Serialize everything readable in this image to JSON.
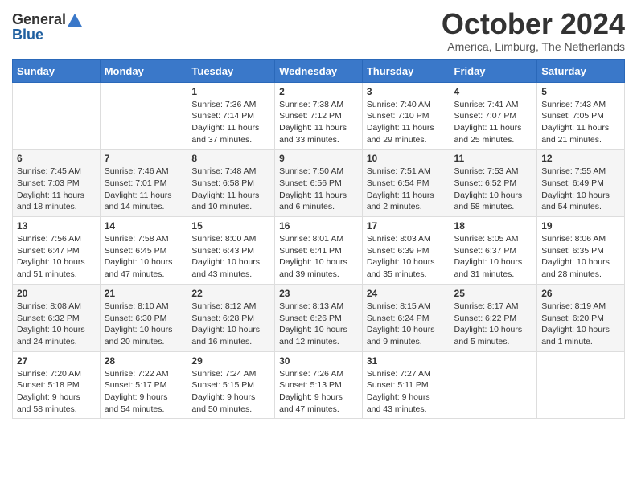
{
  "logo": {
    "line1": "General",
    "line2": "Blue"
  },
  "header": {
    "month": "October 2024",
    "location": "America, Limburg, The Netherlands"
  },
  "days_of_week": [
    "Sunday",
    "Monday",
    "Tuesday",
    "Wednesday",
    "Thursday",
    "Friday",
    "Saturday"
  ],
  "weeks": [
    [
      {
        "day": "",
        "info": ""
      },
      {
        "day": "",
        "info": ""
      },
      {
        "day": "1",
        "info": "Sunrise: 7:36 AM\nSunset: 7:14 PM\nDaylight: 11 hours and 37 minutes."
      },
      {
        "day": "2",
        "info": "Sunrise: 7:38 AM\nSunset: 7:12 PM\nDaylight: 11 hours and 33 minutes."
      },
      {
        "day": "3",
        "info": "Sunrise: 7:40 AM\nSunset: 7:10 PM\nDaylight: 11 hours and 29 minutes."
      },
      {
        "day": "4",
        "info": "Sunrise: 7:41 AM\nSunset: 7:07 PM\nDaylight: 11 hours and 25 minutes."
      },
      {
        "day": "5",
        "info": "Sunrise: 7:43 AM\nSunset: 7:05 PM\nDaylight: 11 hours and 21 minutes."
      }
    ],
    [
      {
        "day": "6",
        "info": "Sunrise: 7:45 AM\nSunset: 7:03 PM\nDaylight: 11 hours and 18 minutes."
      },
      {
        "day": "7",
        "info": "Sunrise: 7:46 AM\nSunset: 7:01 PM\nDaylight: 11 hours and 14 minutes."
      },
      {
        "day": "8",
        "info": "Sunrise: 7:48 AM\nSunset: 6:58 PM\nDaylight: 11 hours and 10 minutes."
      },
      {
        "day": "9",
        "info": "Sunrise: 7:50 AM\nSunset: 6:56 PM\nDaylight: 11 hours and 6 minutes."
      },
      {
        "day": "10",
        "info": "Sunrise: 7:51 AM\nSunset: 6:54 PM\nDaylight: 11 hours and 2 minutes."
      },
      {
        "day": "11",
        "info": "Sunrise: 7:53 AM\nSunset: 6:52 PM\nDaylight: 10 hours and 58 minutes."
      },
      {
        "day": "12",
        "info": "Sunrise: 7:55 AM\nSunset: 6:49 PM\nDaylight: 10 hours and 54 minutes."
      }
    ],
    [
      {
        "day": "13",
        "info": "Sunrise: 7:56 AM\nSunset: 6:47 PM\nDaylight: 10 hours and 51 minutes."
      },
      {
        "day": "14",
        "info": "Sunrise: 7:58 AM\nSunset: 6:45 PM\nDaylight: 10 hours and 47 minutes."
      },
      {
        "day": "15",
        "info": "Sunrise: 8:00 AM\nSunset: 6:43 PM\nDaylight: 10 hours and 43 minutes."
      },
      {
        "day": "16",
        "info": "Sunrise: 8:01 AM\nSunset: 6:41 PM\nDaylight: 10 hours and 39 minutes."
      },
      {
        "day": "17",
        "info": "Sunrise: 8:03 AM\nSunset: 6:39 PM\nDaylight: 10 hours and 35 minutes."
      },
      {
        "day": "18",
        "info": "Sunrise: 8:05 AM\nSunset: 6:37 PM\nDaylight: 10 hours and 31 minutes."
      },
      {
        "day": "19",
        "info": "Sunrise: 8:06 AM\nSunset: 6:35 PM\nDaylight: 10 hours and 28 minutes."
      }
    ],
    [
      {
        "day": "20",
        "info": "Sunrise: 8:08 AM\nSunset: 6:32 PM\nDaylight: 10 hours and 24 minutes."
      },
      {
        "day": "21",
        "info": "Sunrise: 8:10 AM\nSunset: 6:30 PM\nDaylight: 10 hours and 20 minutes."
      },
      {
        "day": "22",
        "info": "Sunrise: 8:12 AM\nSunset: 6:28 PM\nDaylight: 10 hours and 16 minutes."
      },
      {
        "day": "23",
        "info": "Sunrise: 8:13 AM\nSunset: 6:26 PM\nDaylight: 10 hours and 12 minutes."
      },
      {
        "day": "24",
        "info": "Sunrise: 8:15 AM\nSunset: 6:24 PM\nDaylight: 10 hours and 9 minutes."
      },
      {
        "day": "25",
        "info": "Sunrise: 8:17 AM\nSunset: 6:22 PM\nDaylight: 10 hours and 5 minutes."
      },
      {
        "day": "26",
        "info": "Sunrise: 8:19 AM\nSunset: 6:20 PM\nDaylight: 10 hours and 1 minute."
      }
    ],
    [
      {
        "day": "27",
        "info": "Sunrise: 7:20 AM\nSunset: 5:18 PM\nDaylight: 9 hours and 58 minutes."
      },
      {
        "day": "28",
        "info": "Sunrise: 7:22 AM\nSunset: 5:17 PM\nDaylight: 9 hours and 54 minutes."
      },
      {
        "day": "29",
        "info": "Sunrise: 7:24 AM\nSunset: 5:15 PM\nDaylight: 9 hours and 50 minutes."
      },
      {
        "day": "30",
        "info": "Sunrise: 7:26 AM\nSunset: 5:13 PM\nDaylight: 9 hours and 47 minutes."
      },
      {
        "day": "31",
        "info": "Sunrise: 7:27 AM\nSunset: 5:11 PM\nDaylight: 9 hours and 43 minutes."
      },
      {
        "day": "",
        "info": ""
      },
      {
        "day": "",
        "info": ""
      }
    ]
  ]
}
